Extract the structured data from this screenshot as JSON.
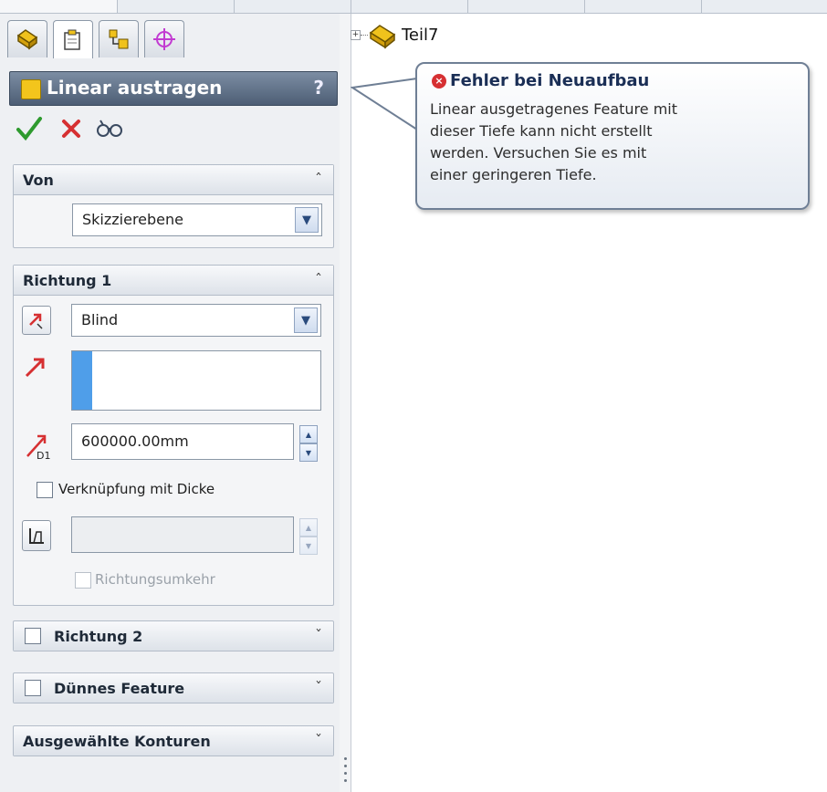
{
  "panel": {
    "title": "Linear austragen",
    "help": "?",
    "tabs": [
      "feature-manager-icon",
      "property-manager-icon",
      "configuration-manager-icon",
      "dimxpert-icon"
    ]
  },
  "actions": {
    "ok": "check-icon",
    "cancel": "close-icon",
    "preview": "preview-glasses-icon"
  },
  "von": {
    "label": "Von",
    "start_condition": "Skizzierebene"
  },
  "richtung1": {
    "label": "Richtung 1",
    "end_condition": "Blind",
    "depth": "600000.00mm",
    "merge_thickness_label": "Verknüpfung mit Dicke",
    "reverse_label": "Richtungsumkehr"
  },
  "richtung2": {
    "label": "Richtung 2"
  },
  "thin_feature": {
    "label": "Dünnes Feature"
  },
  "selected_contours": {
    "label": "Ausgewählte Konturen"
  },
  "tree": {
    "expander": "+",
    "root": "Teil7"
  },
  "tooltip": {
    "title": "Fehler bei Neuaufbau",
    "message": "Linear ausgetragenes Feature mit\ndieser Tiefe kann nicht erstellt\nwerden. Versuchen Sie es mit\neiner geringeren Tiefe."
  },
  "colors": {
    "header_bg": "#5b6d85",
    "accent_blue": "#4f9ee9",
    "error_red": "#d63032",
    "ok_green": "#2e9a2e"
  }
}
